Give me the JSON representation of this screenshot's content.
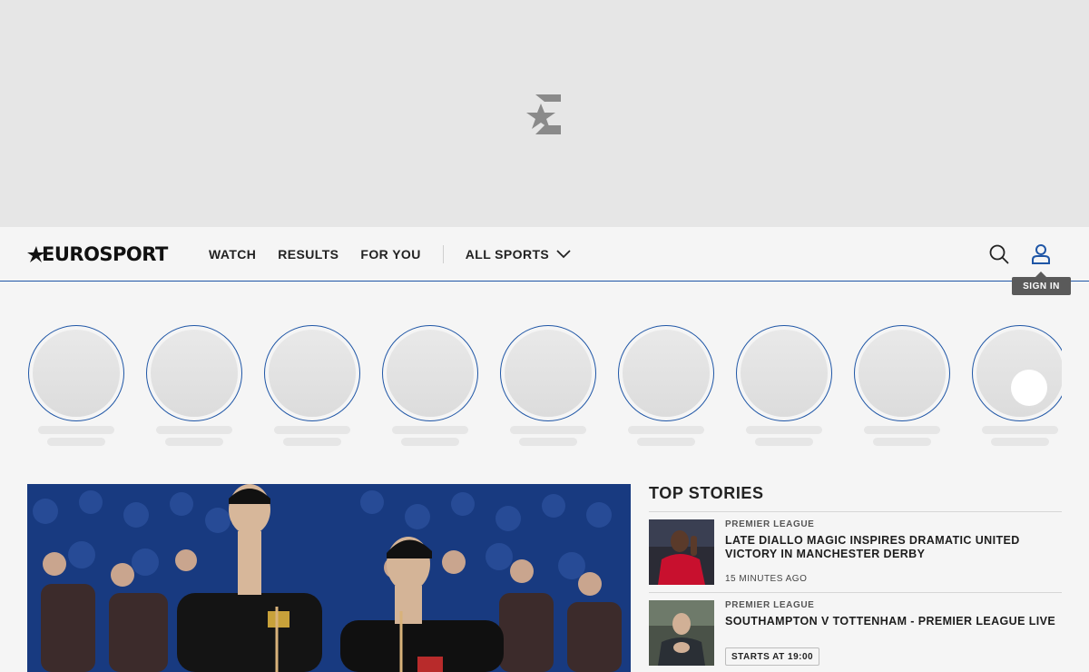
{
  "brand": {
    "name": "EUROSPORT"
  },
  "nav": {
    "links": [
      "WATCH",
      "RESULTS",
      "FOR YOU"
    ],
    "all_sports": "ALL SPORTS",
    "sign_in_tooltip": "SIGN IN"
  },
  "colors": {
    "accent": "#1f56a6",
    "background": "#f5f5f5",
    "ad_background": "#e6e6e6"
  },
  "top_stories": {
    "title": "TOP STORIES",
    "articles": [
      {
        "category": "PREMIER LEAGUE",
        "headline": "LATE DIALLO MAGIC INSPIRES DRAMATIC UNITED VICTORY IN MANCHESTER DERBY",
        "time": "15 MINUTES AGO"
      },
      {
        "category": "PREMIER LEAGUE",
        "headline": "SOUTHAMPTON V TOTTENHAM - PREMIER LEAGUE LIVE",
        "badge": "STARTS AT 19:00"
      }
    ]
  },
  "icons": [
    "eurosport-e-logo-icon",
    "search-icon",
    "user-icon",
    "chevron-down-icon"
  ]
}
